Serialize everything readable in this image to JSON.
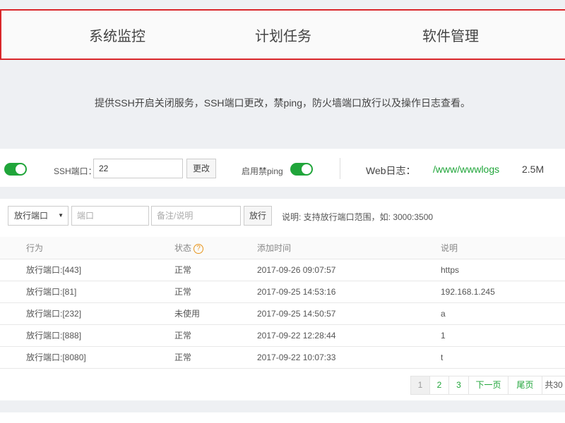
{
  "nav": {
    "items": [
      "系统监控",
      "计划任务",
      "软件管理"
    ]
  },
  "description": "提供SSH开启关闭服务，SSH端口更改，禁ping，防火墙端口放行以及操作日志查看。",
  "ssh": {
    "ssh_enabled": true,
    "port_label": "SSH端口：",
    "port_value": "22",
    "change_button": "更改",
    "ping_label": "启用禁ping",
    "ping_enabled": true
  },
  "weblog": {
    "label": "Web日志：",
    "path": "/www/wwwlogs",
    "size": "2.5M"
  },
  "firewall": {
    "type_select": "放行端口",
    "port_placeholder": "端口",
    "note_placeholder": "备注/说明",
    "allow_button": "放行",
    "hint": "说明: 支持放行端口范围，如: 3000:3500"
  },
  "table": {
    "headers": {
      "action": "行为",
      "status": "状态",
      "added_time": "添加时间",
      "note": "说明"
    },
    "status_help_icon": "?",
    "rows": [
      {
        "action": "放行端口:[443]",
        "status": "正常",
        "time": "2017-09-26 09:07:57",
        "note": "https"
      },
      {
        "action": "放行端口:[81]",
        "status": "正常",
        "time": "2017-09-25 14:53:16",
        "note": "192.168.1.245"
      },
      {
        "action": "放行端口:[232]",
        "status": "未使用",
        "time": "2017-09-25 14:50:57",
        "note": "a"
      },
      {
        "action": "放行端口:[888]",
        "status": "正常",
        "time": "2017-09-22 12:28:44",
        "note": "1"
      },
      {
        "action": "放行端口:[8080]",
        "status": "正常",
        "time": "2017-09-22 10:07:33",
        "note": "t"
      }
    ]
  },
  "pagination": {
    "pages": [
      "1",
      "2",
      "3"
    ],
    "current": "1",
    "next": "下一页",
    "last": "尾页",
    "total": "共30"
  },
  "colors": {
    "accent": "#20a53a",
    "nav_border": "#d9262a",
    "help_icon": "#e8941a"
  }
}
